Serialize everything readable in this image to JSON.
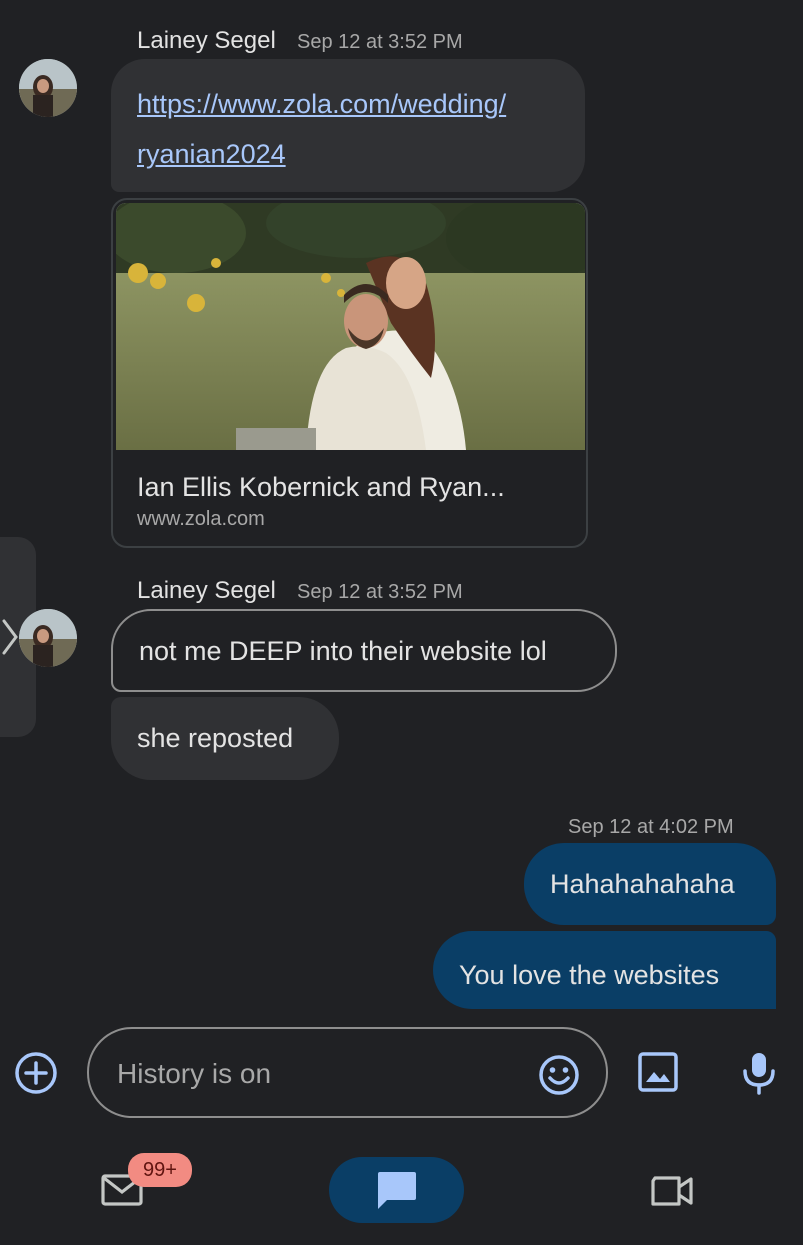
{
  "messages": {
    "group1": {
      "sender": "Lainey Segel",
      "time": "Sep 12 at 3:52 PM",
      "link_line1": "https://www.zola.com/wedding/",
      "link_line2": "ryanian2024",
      "preview": {
        "title": "Ian Ellis Kobernick and Ryan...",
        "domain": "www.zola.com"
      }
    },
    "group2": {
      "sender": "Lainey Segel",
      "time": "Sep 12 at 3:52 PM",
      "msg1": "not me DEEP into their website lol",
      "msg2": "she reposted"
    },
    "outgoing": {
      "time": "Sep 12 at 4:02 PM",
      "msg1": "Hahahahahaha",
      "msg2": "You love the websites"
    }
  },
  "composer": {
    "placeholder": "History is on"
  },
  "bottom_nav": {
    "mail_badge": "99+"
  },
  "colors": {
    "background": "#202124",
    "incoming_bubble": "#303134",
    "outgoing_bubble": "#0a3e66",
    "accent": "#a8c7fa",
    "badge": "#f28b82"
  }
}
